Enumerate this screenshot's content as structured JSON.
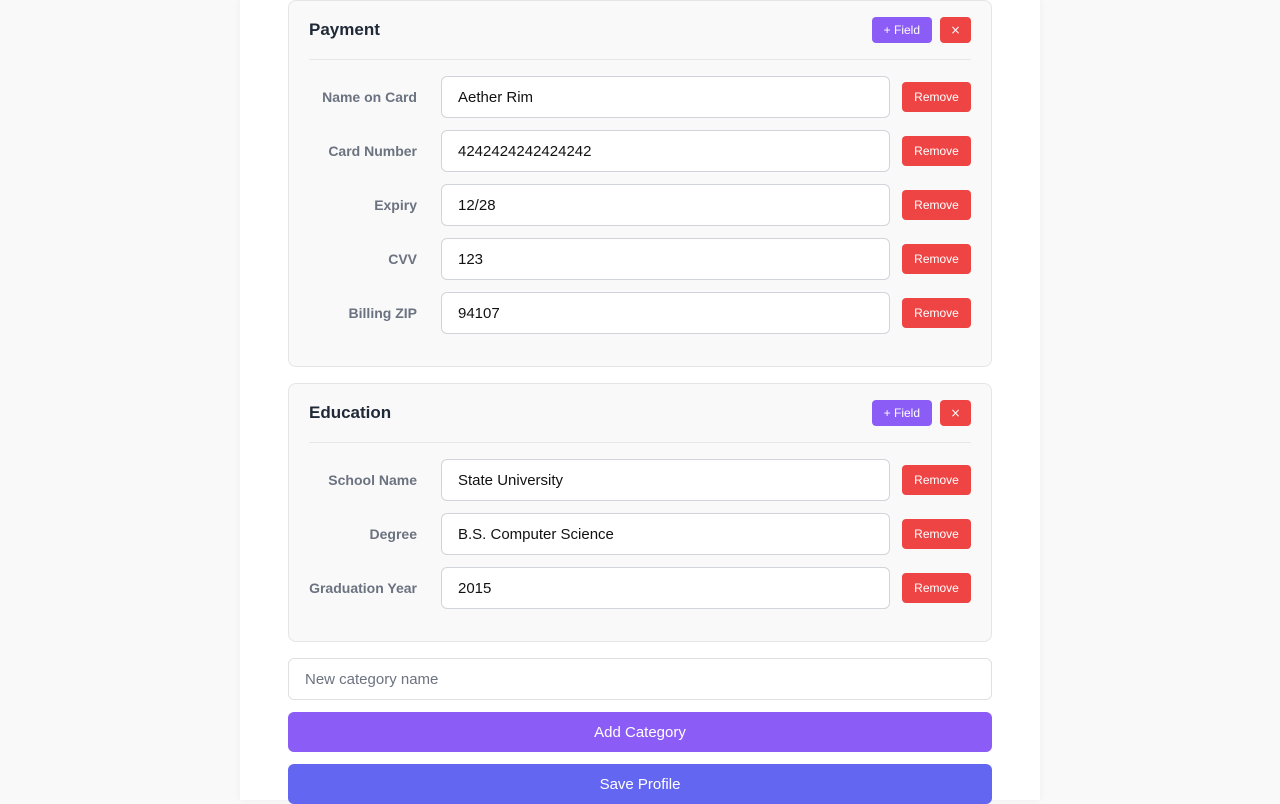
{
  "categories": [
    {
      "title": "Payment",
      "add_field_label": "+ Field",
      "delete_label": "×",
      "fields": [
        {
          "label": "Name on Card",
          "value": "Aether Rim",
          "remove_label": "Remove"
        },
        {
          "label": "Card Number",
          "value": "4242424242424242",
          "remove_label": "Remove"
        },
        {
          "label": "Expiry",
          "value": "12/28",
          "remove_label": "Remove"
        },
        {
          "label": "CVV",
          "value": "123",
          "remove_label": "Remove"
        },
        {
          "label": "Billing ZIP",
          "value": "94107",
          "remove_label": "Remove"
        }
      ]
    },
    {
      "title": "Education",
      "add_field_label": "+ Field",
      "delete_label": "×",
      "fields": [
        {
          "label": "School Name",
          "value": "State University",
          "remove_label": "Remove"
        },
        {
          "label": "Degree",
          "value": "B.S. Computer Science",
          "remove_label": "Remove"
        },
        {
          "label": "Graduation Year",
          "value": "2015",
          "remove_label": "Remove"
        }
      ]
    }
  ],
  "new_category": {
    "placeholder": "New category name",
    "value": ""
  },
  "add_category_label": "Add Category",
  "save_profile_label": "Save Profile",
  "colors": {
    "accent_purple": "#8b5cf6",
    "save_indigo": "#6366f1",
    "danger_red": "#ef4444"
  }
}
